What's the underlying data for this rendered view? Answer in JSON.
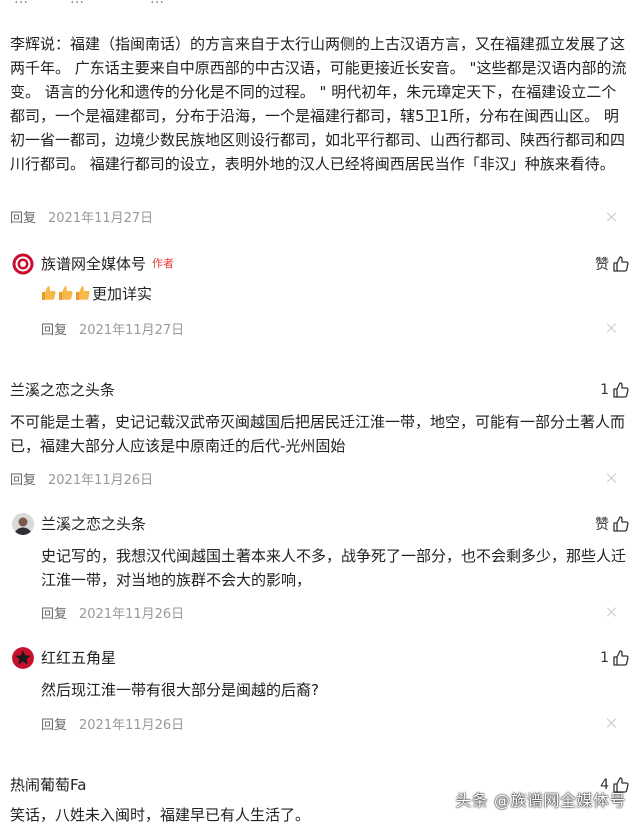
{
  "top_fragment": [
    "…",
    "…",
    "…"
  ],
  "thread": {
    "comment": {
      "text": "李辉说：福建（指闽南话）的方言来自于太行山两侧的上古汉语方言，又在福建孤立发展了这两千年。 广东话主要来自中原西部的中古汉语，可能更接近长安音。 \"这些都是汉语内部的流变。 语言的分化和遗传的分化是不同的过程。 \" 明代初年，朱元璋定天下，在福建设立二个都司，一个是福建都司，分布于沿海，一个是福建行都司，辖5卫1所，分布在闽西山区。 明初一省一都司，边境少数民族地区则设行都司，如北平行都司、山西行都司、陕西行都司和四川行都司。 福建行都司的设立，表明外地的汉人已经将闽西居民当作「非汉」种族来看待。",
      "reply_label": "回复",
      "date": "2021年11月27日"
    },
    "reply": {
      "user": "族谱网全媒体号",
      "author_tag": "作者",
      "like_label": "赞",
      "text": "更加详实",
      "reply_label": "回复",
      "date": "2021年11月27日"
    }
  },
  "thread2": {
    "comment": {
      "user": "兰溪之恋之头条",
      "likes": "1",
      "text": "不可能是土著，史记记载汉武帝灭闽越国后把居民迁江淮一带，地空，可能有一部分土著人而已，福建大部分人应该是中原南迁的后代-光州固始",
      "reply_label": "回复",
      "date": "2021年11月26日"
    },
    "replies": [
      {
        "user": "兰溪之恋之头条",
        "like_label": "赞",
        "text": "史记写的，我想汉代闽越国土著本来人不多，战争死了一部分，也不会剩多少，那些人迁江淮一带，对当地的族群不会大的影响，",
        "reply_label": "回复",
        "date": "2021年11月26日"
      },
      {
        "user": "红红五角星",
        "likes": "1",
        "text": "然后现江淮一带有很大部分是闽越的后裔?",
        "reply_label": "回复",
        "date": "2021年11月26日"
      }
    ]
  },
  "thread3": {
    "comment": {
      "user": "热闹葡萄Fa",
      "likes": "4",
      "text": "笑话，八姓未入闽时，福建早已有人生活了。"
    }
  },
  "watermark": "头条 @族谱网全媒体号",
  "colors": {
    "text": "#222222",
    "meta": "#999999",
    "author_tag": "#e4393c",
    "avatar_red": "#c8102e"
  },
  "icons": [
    "thumbs-up-icon",
    "close-icon",
    "star-avatar-icon",
    "logo-avatar-icon"
  ]
}
